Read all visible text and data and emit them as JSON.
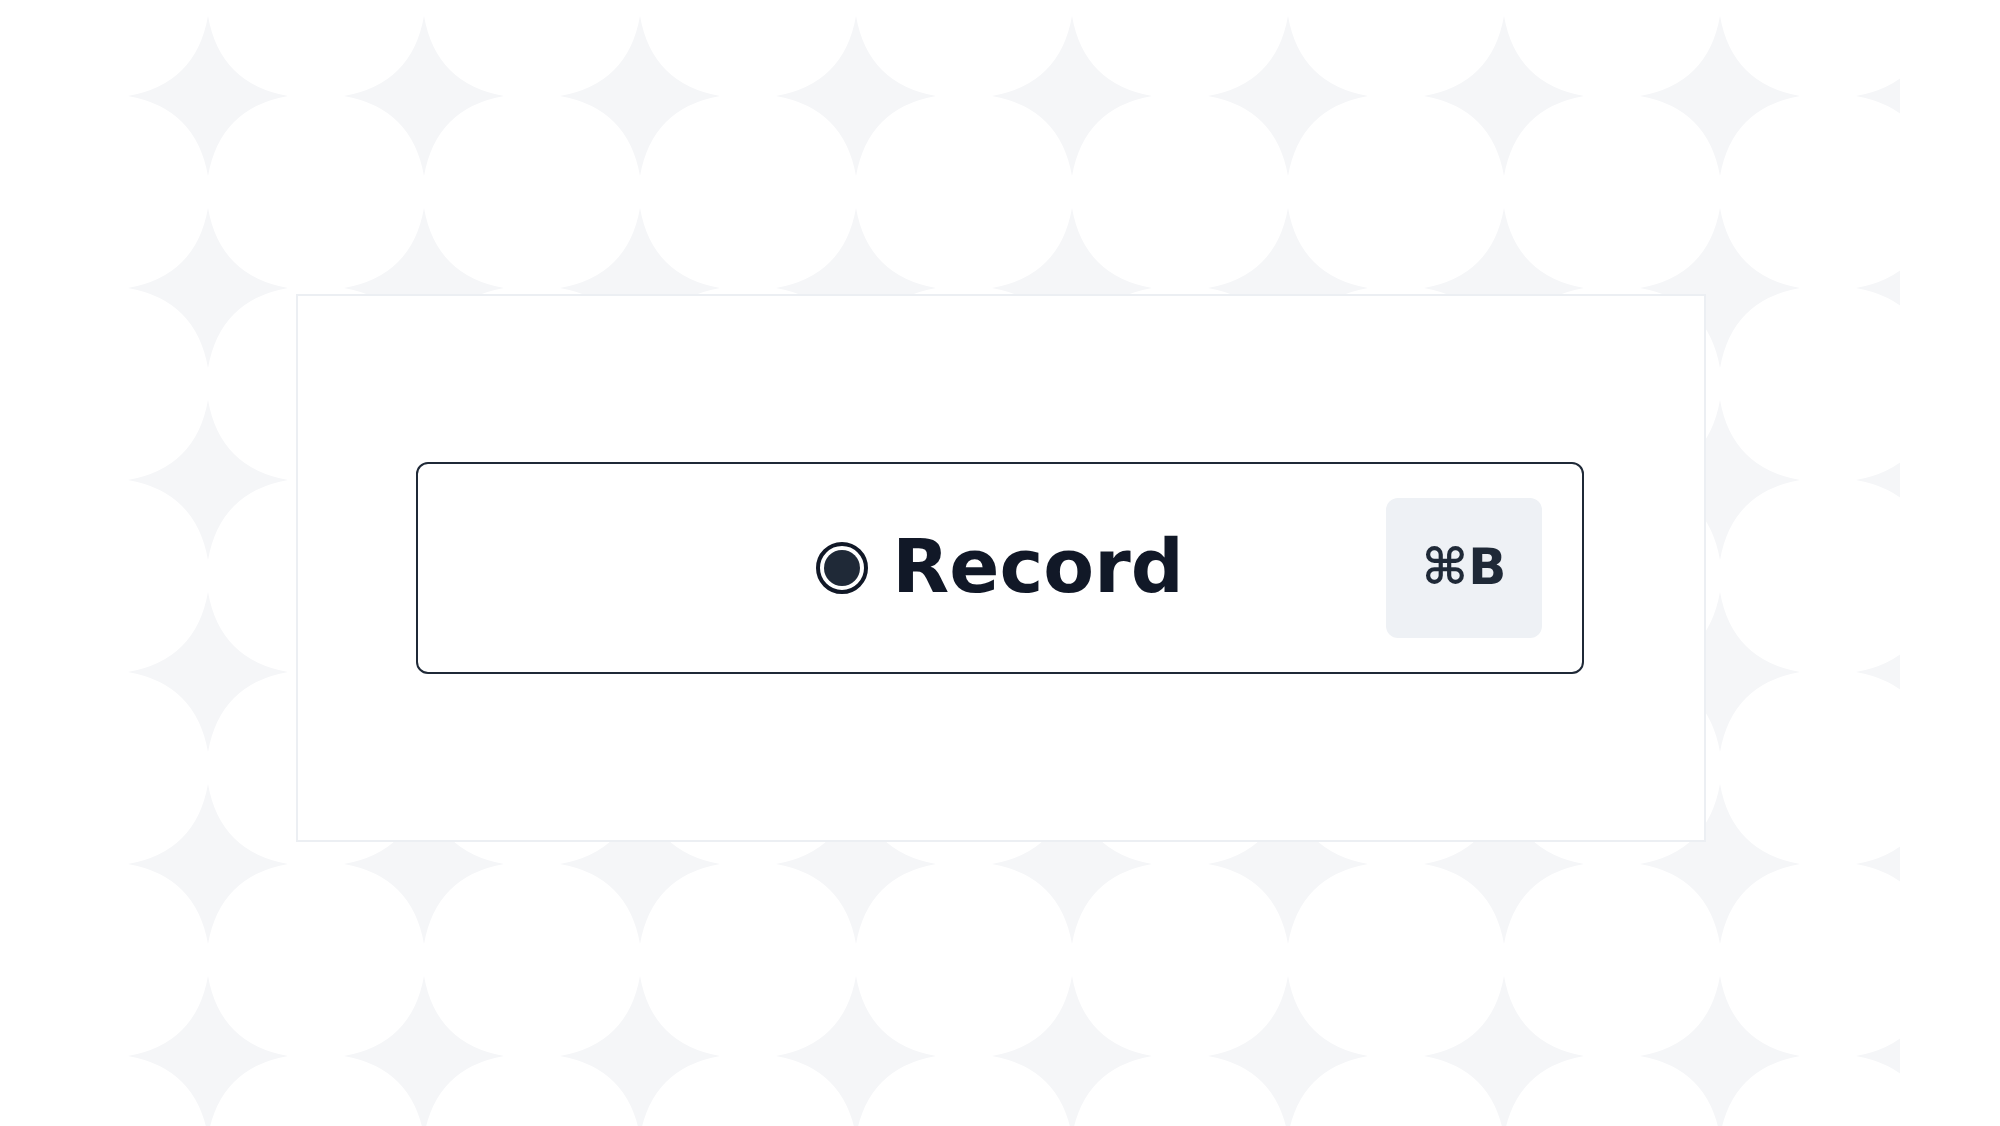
{
  "button": {
    "label": "Record",
    "shortcut": "⌘B"
  }
}
